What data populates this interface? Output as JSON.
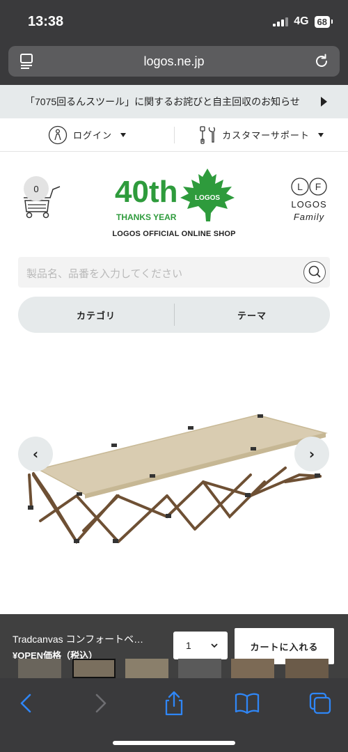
{
  "status": {
    "time": "13:38",
    "network": "4G",
    "battery": "68"
  },
  "browser": {
    "url": "logos.ne.jp"
  },
  "notice": {
    "text": "「7075回るんスツール」に関するお詫びと自主回収のお知らせ"
  },
  "account": {
    "login_label": "ログイン",
    "support_label": "カスタマーサポート"
  },
  "header": {
    "cart_count": "0",
    "logo_40": "40th",
    "logo_thanks": "THANKS YEAR",
    "logo_brand": "LOGOS",
    "shop_name": "LOGOS OFFICIAL ONLINE SHOP",
    "family_logo": {
      "l": "L",
      "f": "F",
      "line1": "LOGOS",
      "line2": "Family"
    }
  },
  "search": {
    "placeholder": "製品名、品番を入力してください"
  },
  "categories": {
    "category_label": "カテゴリ",
    "theme_label": "テーマ"
  },
  "purchase": {
    "product_title": "Tradcanvas コンフォートベ…",
    "price_label": "¥OPEN価格（税込）",
    "quantity": "1",
    "add_to_cart": "カートに入れる"
  },
  "colors": {
    "brand_green": "#2e9b3c",
    "cot_fabric": "#d9ccb1",
    "cot_frame": "#6e5034",
    "chrome_dark": "#3a3a3c",
    "link_blue": "#2f86f6"
  }
}
